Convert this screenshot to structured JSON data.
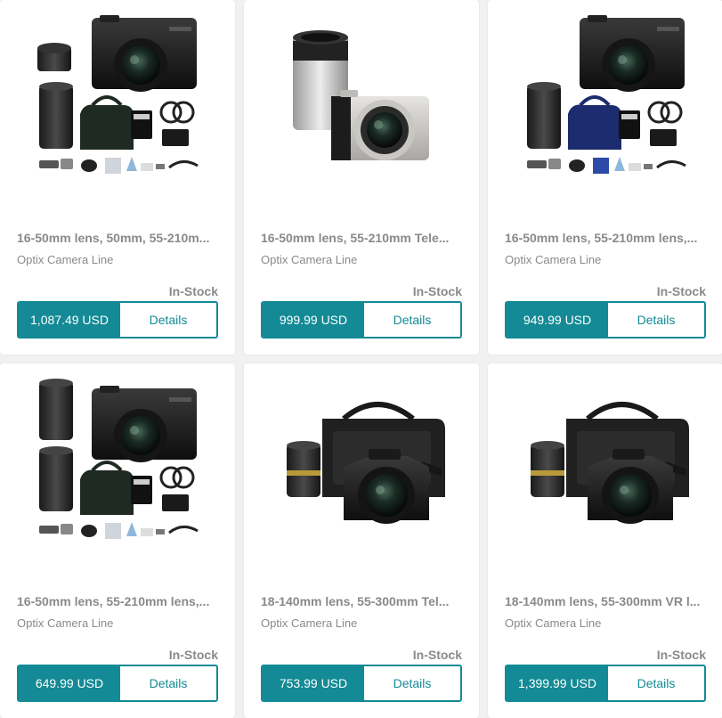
{
  "colors": {
    "accent": "#138a95",
    "text_muted": "#8a8a8a",
    "background": "#f1f1f1",
    "card": "#ffffff"
  },
  "products": [
    {
      "title": "16-50mm lens, 50mm, 55-210m...",
      "line": "Optix Camera Line",
      "stock": "In-Stock",
      "price": "1,087.49 USD",
      "details_label": "Details",
      "image": "mirrorless-camera-bundle-black"
    },
    {
      "title": "16-50mm lens, 55-210mm Tele...",
      "line": "Optix Camera Line",
      "stock": "In-Stock",
      "price": "999.99 USD",
      "details_label": "Details",
      "image": "mirrorless-camera-silver-telephoto"
    },
    {
      "title": "16-50mm lens, 55-210mm lens,...",
      "line": "Optix Camera Line",
      "stock": "In-Stock",
      "price": "949.99 USD",
      "details_label": "Details",
      "image": "mirrorless-camera-bundle-blue-bag"
    },
    {
      "title": "16-50mm lens, 55-210mm lens,...",
      "line": "Optix Camera Line",
      "stock": "In-Stock",
      "price": "649.99 USD",
      "details_label": "Details",
      "image": "mirrorless-camera-bundle-two-lenses"
    },
    {
      "title": "18-140mm lens, 55-300mm Tel...",
      "line": "Optix Camera Line",
      "stock": "In-Stock",
      "price": "753.99 USD",
      "details_label": "Details",
      "image": "dslr-camera-bag-bundle"
    },
    {
      "title": "18-140mm lens, 55-300mm VR l...",
      "line": "Optix Camera Line",
      "stock": "In-Stock",
      "price": "1,399.99 USD",
      "details_label": "Details",
      "image": "dslr-camera-bag-bundle"
    }
  ]
}
